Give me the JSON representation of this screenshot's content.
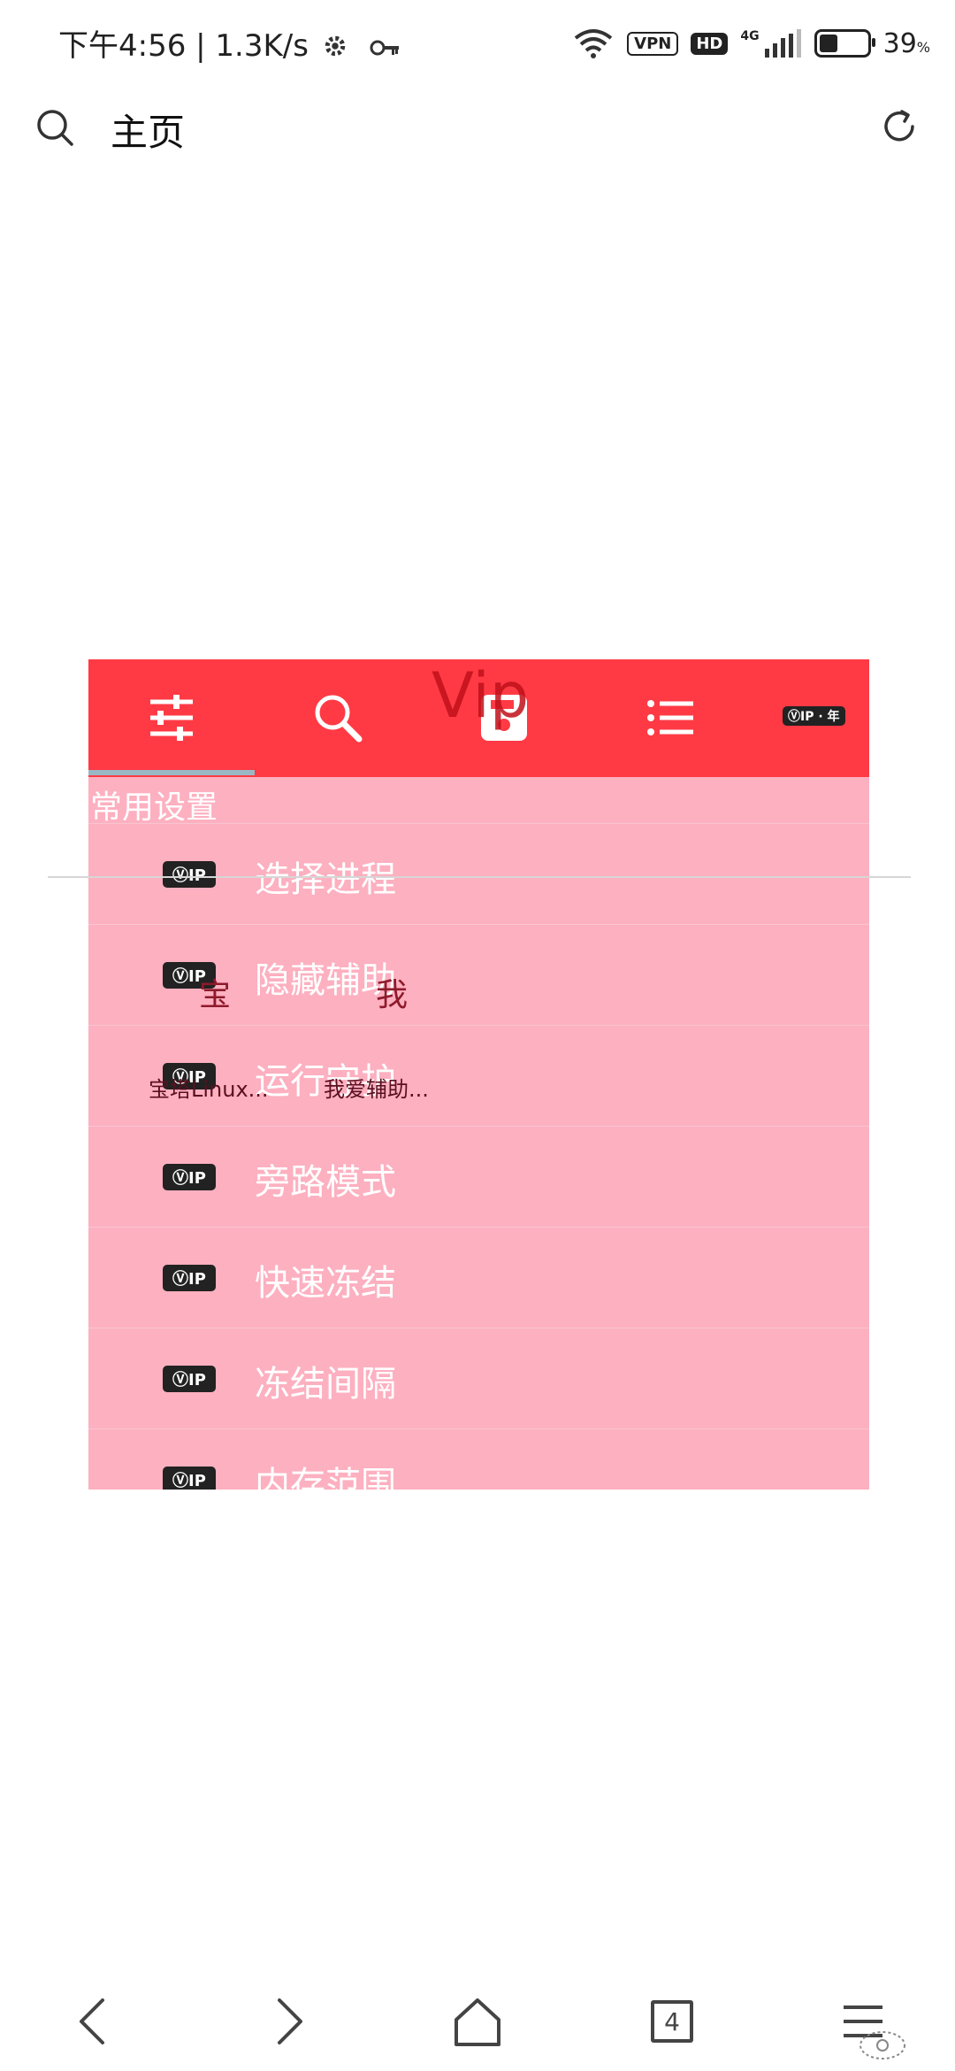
{
  "status_bar": {
    "time": "下午4:56 | 1.3K/s",
    "vpn": "VPN",
    "hd": "HD",
    "network": "4G",
    "battery_value": "39",
    "battery_unit": "%",
    "battery_level": 0.39
  },
  "header": {
    "title": "主页"
  },
  "overlay": {
    "ghost_title": "Vip",
    "top_vip_label": "ⓋIP · 年",
    "section_label": "常用设置",
    "rows": [
      {
        "vip": "ⓋIP",
        "label": "选择进程"
      },
      {
        "vip": "ⓋIP",
        "label": "隐藏辅助"
      },
      {
        "vip": "ⓋIP",
        "label": "运行守护"
      },
      {
        "vip": "ⓋIP",
        "label": "旁路模式"
      },
      {
        "vip": "ⓋIP",
        "label": "快速冻结"
      },
      {
        "vip": "ⓋIP",
        "label": "冻结间隔"
      },
      {
        "vip": "ⓋIP",
        "label": "内存范围"
      }
    ],
    "ghost_items": [
      {
        "big": "宝",
        "small": "宝塔Linux..."
      },
      {
        "big": "我",
        "small": "我爱辅助..."
      }
    ]
  },
  "bottom_nav": {
    "tab_count": "4"
  }
}
